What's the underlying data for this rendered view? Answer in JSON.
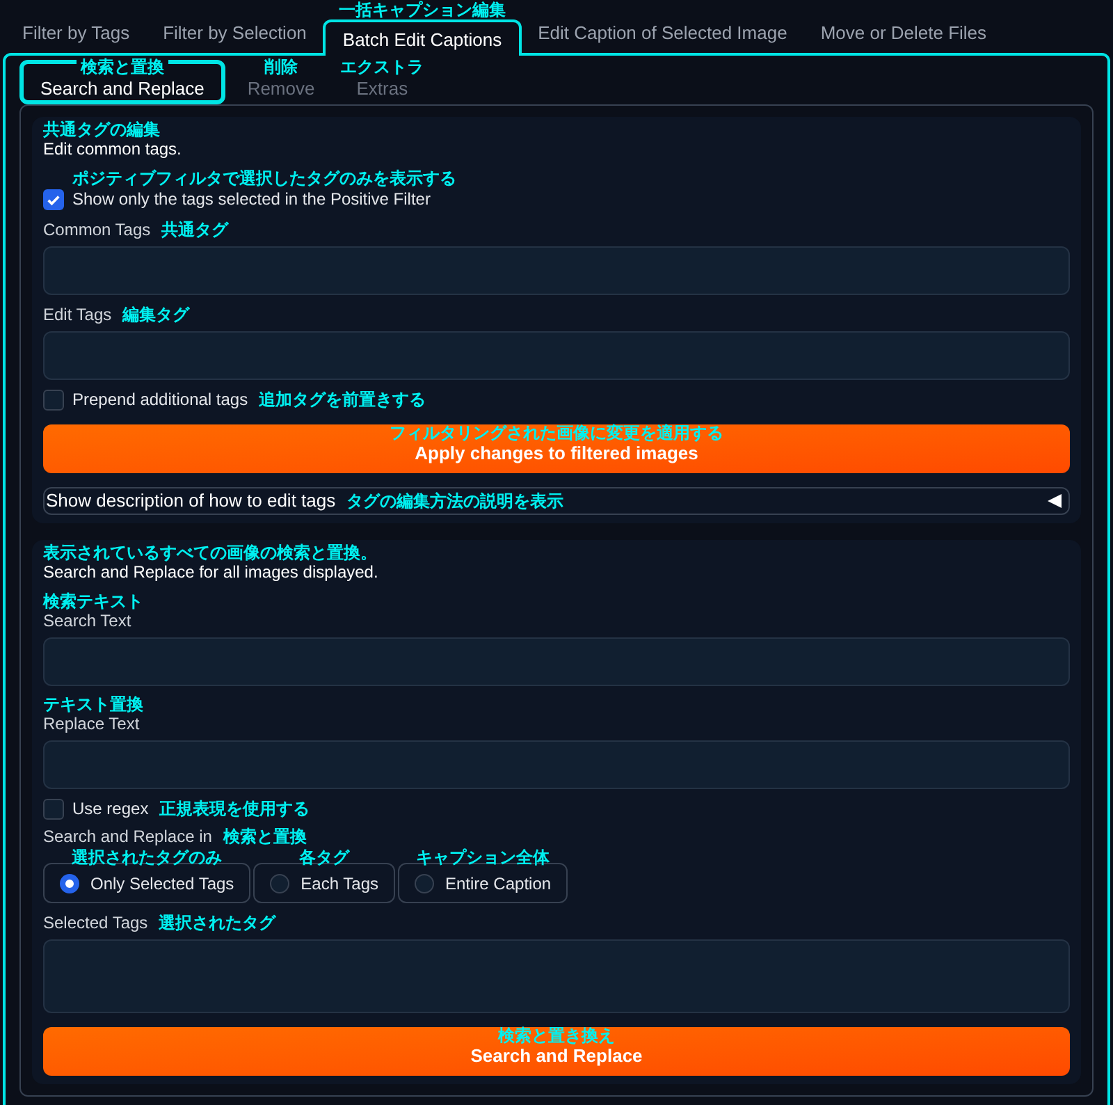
{
  "tabs": [
    {
      "label": "Filter by Tags",
      "selected": false
    },
    {
      "label": "Filter by Selection",
      "selected": false
    },
    {
      "label": "Batch Edit Captions",
      "translation": "一括キャプション編集",
      "selected": true
    },
    {
      "label": "Edit Caption of Selected Image",
      "selected": false
    },
    {
      "label": "Move or Delete Files",
      "selected": false
    }
  ],
  "subtabs": [
    {
      "label": "Search and Replace",
      "translation": "検索と置換",
      "selected": true
    },
    {
      "label": "Remove",
      "translation": "削除",
      "selected": false
    },
    {
      "label": "Extras",
      "translation": "エクストラ",
      "selected": false
    }
  ],
  "sections": [
    {
      "heading_translation": "共通タグの編集",
      "heading": "Edit common tags.",
      "items": [
        {
          "kind": "checkbox",
          "label": "Show only the tags selected in the Positive Filter",
          "translation_above": "ポジティブフィルタで選択したタグのみを表示する",
          "checked": true
        },
        {
          "kind": "textbox",
          "label": "Common Tags",
          "translation": "共通タグ"
        },
        {
          "kind": "textbox",
          "label": "Edit Tags",
          "translation": "編集タグ"
        },
        {
          "kind": "checkbox",
          "label": "Prepend additional tags",
          "translation": "追加タグを前置きする",
          "checked": false
        },
        {
          "kind": "button",
          "label": "Apply changes to filtered images",
          "translation": "フィルタリングされた画像に変更を適用する"
        },
        {
          "kind": "accordion",
          "label": "Show description of how to edit tags",
          "translation": "タグの編集方法の説明を表示",
          "expanded": false
        }
      ]
    },
    {
      "heading_translation": "表示されているすべての画像の検索と置換。",
      "heading": "Search and Replace for all images displayed.",
      "items": [
        {
          "kind": "textbox",
          "label": "Search Text",
          "translation_above": "検索テキスト"
        },
        {
          "kind": "textbox",
          "label": "Replace Text",
          "translation_above": "テキスト置換"
        },
        {
          "kind": "checkbox",
          "label": "Use regex",
          "translation": "正規表現を使用する",
          "checked": false
        },
        {
          "kind": "radio_group",
          "label": "Search and Replace in",
          "translation": "検索と置換",
          "options": [
            {
              "label": "Only Selected Tags",
              "translation": "選択されたタグのみ",
              "selected": true
            },
            {
              "label": "Each Tags",
              "translation": "各タグ",
              "selected": false
            },
            {
              "label": "Entire Caption",
              "translation": "キャプション全体",
              "selected": false
            }
          ]
        },
        {
          "kind": "textarea",
          "label": "Selected Tags",
          "translation": "選択されたタグ"
        },
        {
          "kind": "button",
          "label": "Search and Replace",
          "translation": "検索と置き換え"
        }
      ]
    }
  ]
}
